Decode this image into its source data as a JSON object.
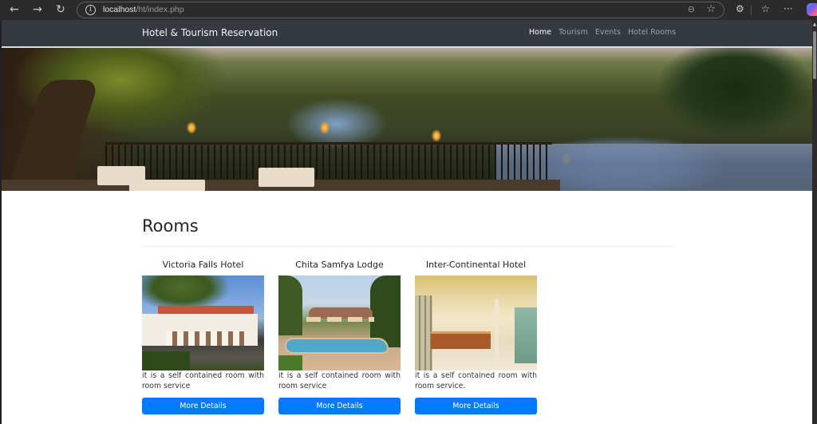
{
  "browser": {
    "url_host": "localhost",
    "url_path": "/ht/index.php",
    "icons": {
      "back": "←",
      "forward": "→",
      "reload": "↻",
      "site_info": "i",
      "zoom": "⊖",
      "favorite": "☆",
      "extensions": "⚙",
      "favorites_list": "☆",
      "more": "···"
    }
  },
  "navbar": {
    "brand": "Hotel & Tourism Reservation",
    "links": [
      {
        "label": "Home",
        "active": true
      },
      {
        "label": "Tourism",
        "active": false
      },
      {
        "label": "Events",
        "active": false
      },
      {
        "label": "Hotel Rooms",
        "active": false
      }
    ]
  },
  "hero": {
    "description": "Riverside terrace dining with lanterns at dusk"
  },
  "rooms": {
    "title": "Rooms",
    "cards": [
      {
        "name": "Victoria Falls Hotel",
        "image": "white colonial hotel with red roof and trees",
        "description": "it is a self contained room with room service",
        "button": "More Details"
      },
      {
        "name": "Chita Samfya Lodge",
        "image": "lodge with swimming pool and umbrellas",
        "description": "it is a self contained room with room service",
        "button": "More Details"
      },
      {
        "name": "Inter-Continental Hotel",
        "image": "hotel lobby with reception desk",
        "description": "it is a self contained room with room service.",
        "button": "More Details"
      }
    ]
  },
  "colors": {
    "navbar_bg": "#343a40",
    "primary_button": "#007bff",
    "browser_chrome": "#2b2b2b"
  }
}
